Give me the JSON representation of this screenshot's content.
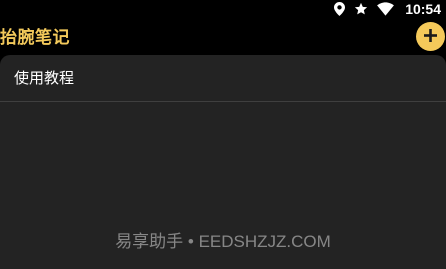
{
  "status_bar": {
    "time": "10:54",
    "icons": [
      "location-icon",
      "star-icon",
      "wifi-icon"
    ]
  },
  "header": {
    "title": "抬腕笔记",
    "add_button_icon": "plus-icon"
  },
  "notes": [
    {
      "title": "使用教程"
    }
  ],
  "watermark": "易享助手 • EEDSHZJZ.COM",
  "colors": {
    "background": "#000000",
    "accent": "#f4c95a",
    "panel": "#232323",
    "divider": "#3f3f3f"
  }
}
